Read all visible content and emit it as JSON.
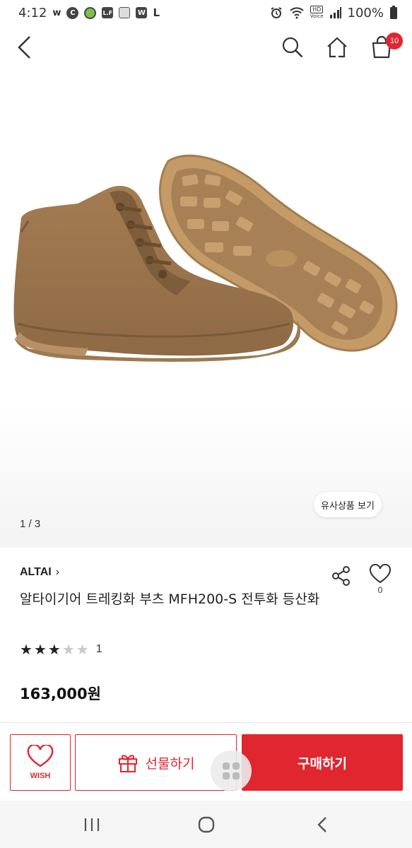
{
  "status_bar": {
    "time": "4:12",
    "left_icons": [
      "w",
      "C",
      "L.F",
      "W",
      "L"
    ],
    "battery": "100%",
    "hd_label": "HD",
    "voice_label": "Voice"
  },
  "nav": {
    "cart_count": "10"
  },
  "gallery": {
    "similar_label": "유사상품 보기",
    "counter": "1 / 3"
  },
  "product": {
    "brand": "ALTAI",
    "brand_chevron": "›",
    "title": "알타이기어 트레킹화 부츠 MFH200-S 전투화 등산화",
    "rating": 3,
    "rating_max": 5,
    "review_count": "1",
    "wish_count": "0",
    "price": "163,000원"
  },
  "actions": {
    "wish_label": "WISH",
    "gift_label": "선물하기",
    "buy_label": "구매하기"
  },
  "colors": {
    "accent": "#e0262f",
    "boot": "#b08a5e"
  }
}
